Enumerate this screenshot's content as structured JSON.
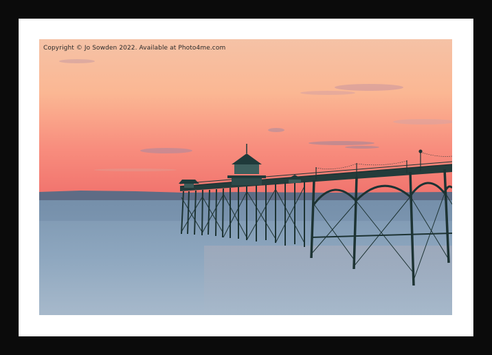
{
  "print": {
    "frame_color": "#0b0b0b",
    "mount_color": "#ffffff",
    "copyright_text": "Copyright © Jo Sowden 2022. Available at Photo4me.com"
  },
  "scene": {
    "sky_colors": [
      "#fbb897",
      "#f79886",
      "#f47b73"
    ],
    "water_colors": [
      "#8ea7bf",
      "#6f8aa5",
      "#7f97ae"
    ],
    "pier_color": "#1d3333"
  }
}
